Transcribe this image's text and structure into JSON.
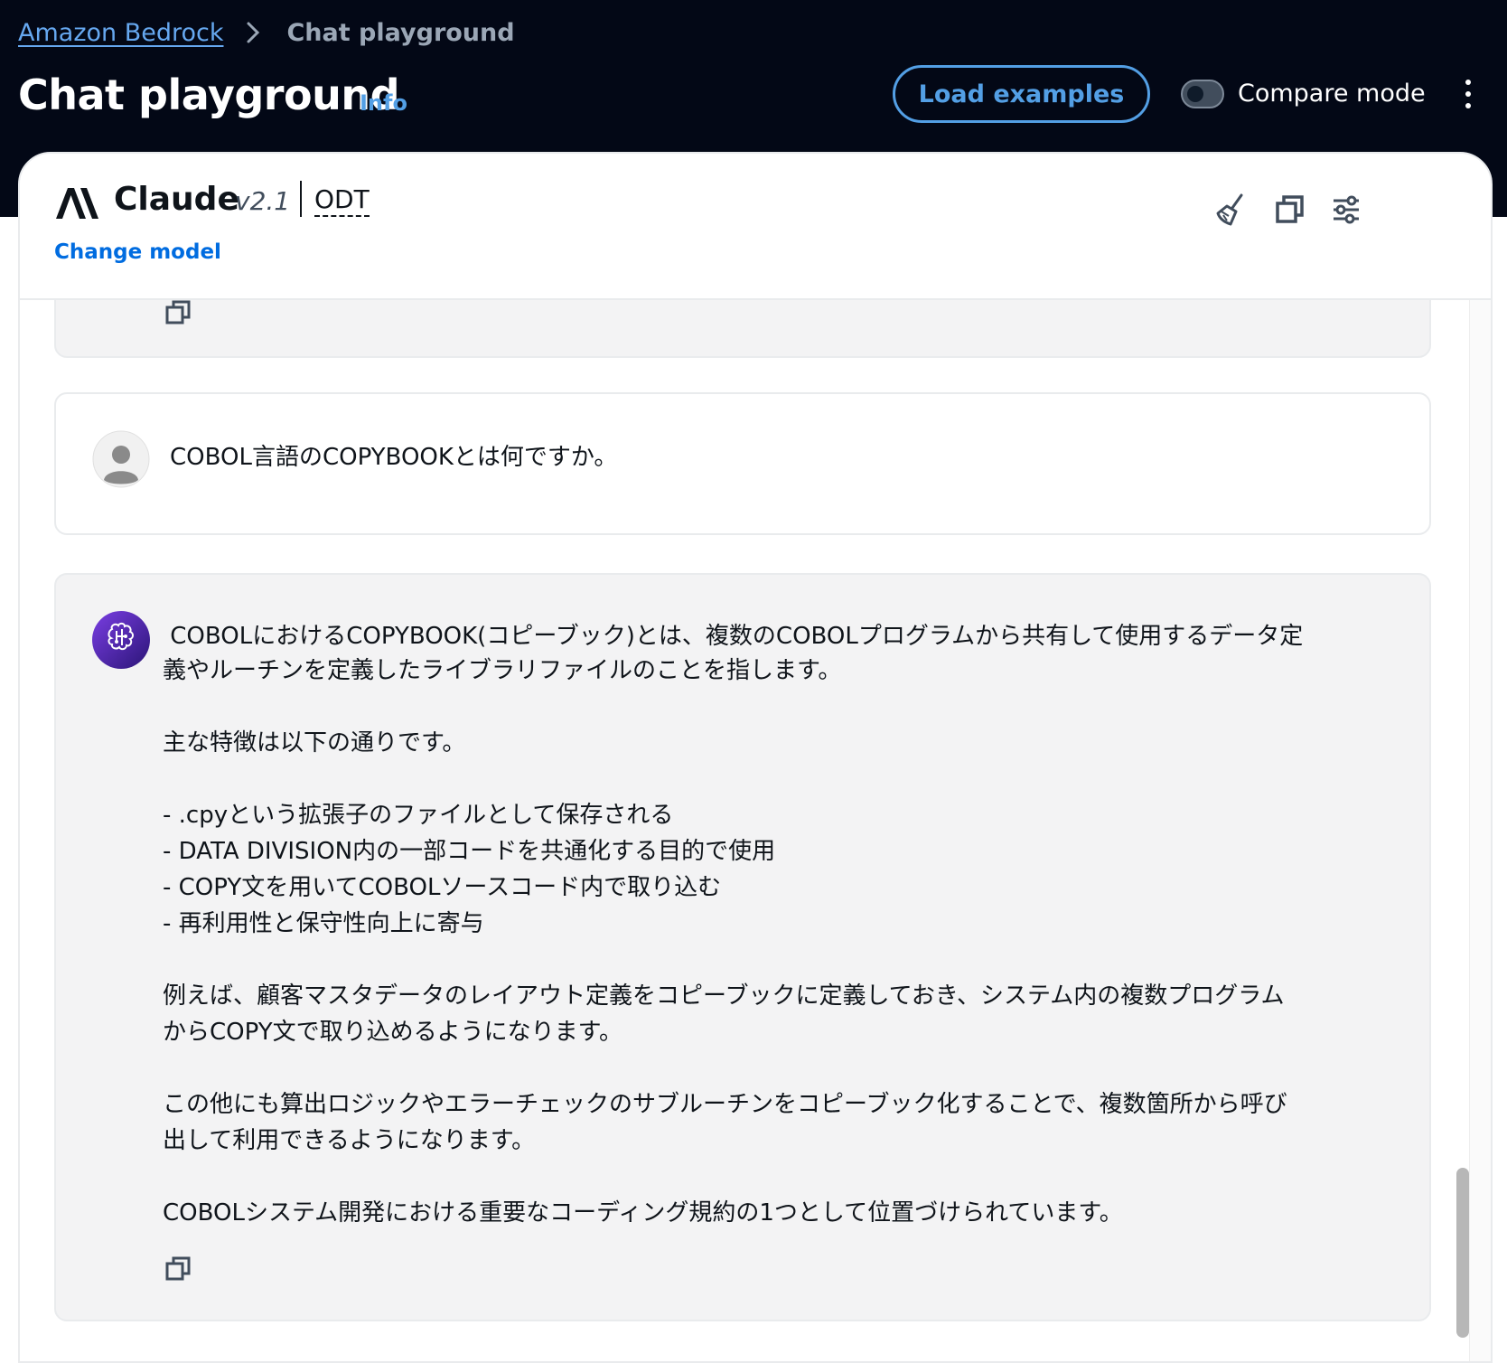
{
  "breadcrumb": {
    "root": "Amazon Bedrock",
    "current": "Chat playground"
  },
  "header": {
    "title": "Chat playground",
    "info": "Info",
    "load_examples": "Load examples",
    "compare_mode": "Compare mode",
    "compare_mode_on": false
  },
  "model": {
    "name": "Claude",
    "version": "v2.1",
    "tag": "ODT",
    "change_model": "Change model"
  },
  "conversation": {
    "user_message": "COBOL言語のCOPYBOOKとは何ですか。",
    "assistant_first_line": " COBOLにおけるCOPYBOOK(コピーブック)とは、複数のCOBOLプログラムから共有して使用するデータ定",
    "assistant_body": "義やルーチンを定義したライブラリファイルのことを指します。\n\n主な特徴は以下の通りです。\n\n- .cpyという拡張子のファイルとして保存される\n- DATA DIVISION内の一部コードを共通化する目的で使用\n- COPY文を用いてCOBOLソースコード内で取り込む\n- 再利用性と保守性向上に寄与\n\n例えば、顧客マスタデータのレイアウト定義をコピーブックに定義しておき、システム内の複数プログラム\nからCOPY文で取り込めるようになります。\n\nこの他にも算出ロジックやエラーチェックのサブルーチンをコピーブック化することで、複数箇所から呼び\n出して利用できるようになります。\n\nCOBOLシステム開発における重要なコーディング規約の1つとして位置づけられています。"
  },
  "icons": {
    "clear": "broom-icon",
    "copy": "copy-icon",
    "settings": "sliders-icon",
    "more": "kebab-icon",
    "user": "user-avatar-icon",
    "assistant": "brain-chip-icon"
  },
  "colors": {
    "topbar_bg": "#030816",
    "link_blue": "#539fe5",
    "change_model_blue": "#006ce0",
    "bot_bubble_bg": "#f3f3f4",
    "assistant_avatar": "#6a32d8"
  }
}
